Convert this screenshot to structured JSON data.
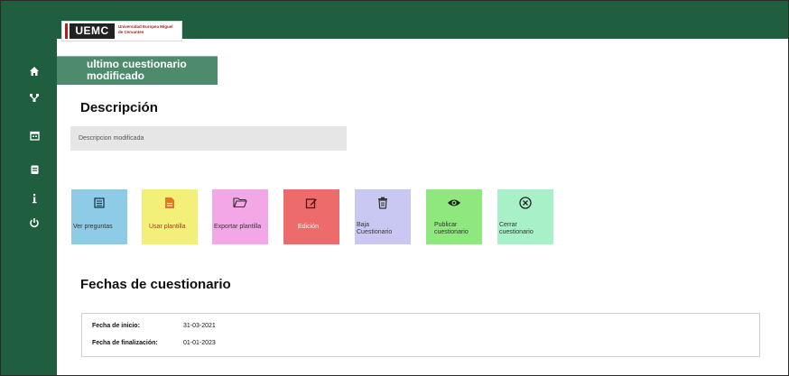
{
  "brand": {
    "logo_text": "UEMC",
    "logo_subtitle": "Universidad Europea Miguel de Cervantes",
    "primary_color": "#1f5e3f",
    "accent_color": "#4e8b6c"
  },
  "sidebar": {
    "items": [
      {
        "icon": "home-icon"
      },
      {
        "icon": "sitemap-icon"
      },
      {
        "icon": "calendar-icon"
      },
      {
        "icon": "clipboard-icon"
      },
      {
        "icon": "info-icon"
      },
      {
        "icon": "power-icon"
      }
    ]
  },
  "questionnaire": {
    "title": "ultimo cuestionario modificado",
    "description_heading": "Descripción",
    "description_value": "Descripcion modificada"
  },
  "actions": [
    {
      "label": "Ver preguntas",
      "icon": "list-icon",
      "color": "#8ecbe6",
      "label_color": "#333333"
    },
    {
      "label": "Usar plantilla",
      "icon": "file-icon",
      "color": "#f3f07a",
      "label_color": "#b13a1a"
    },
    {
      "label": "Exportar plantilla",
      "icon": "folder-icon",
      "color": "#f3a7e6",
      "label_color": "#333333"
    },
    {
      "label": "Edición",
      "icon": "edit-icon",
      "color": "#ee6b6b",
      "label_color": "#ffffff"
    },
    {
      "label": "Baja Cuestionario",
      "icon": "trash-icon",
      "color": "#c9c8f3",
      "label_color": "#333333"
    },
    {
      "label": "Publicar cuestionario",
      "icon": "eye-icon",
      "color": "#8fe87e",
      "label_color": "#333333"
    },
    {
      "label": "Cerrar cuestionario",
      "icon": "close-circle-icon",
      "color": "#a7f0c8",
      "label_color": "#333333"
    }
  ],
  "dates": {
    "heading": "Fechas de cuestionario",
    "start_label": "Fecha de inicio:",
    "start_value": "31-03-2021",
    "end_label": "Fecha de finalización:",
    "end_value": "01-01-2023"
  }
}
